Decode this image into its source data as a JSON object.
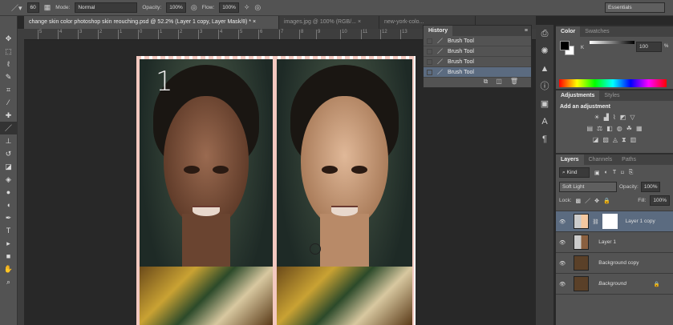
{
  "options_bar": {
    "brush_size": "60",
    "mode_label": "Mode:",
    "mode_value": "Normal",
    "opacity_label": "Opacity:",
    "opacity_value": "100%",
    "flow_label": "Flow:",
    "flow_value": "100%",
    "workspace": "Essentials"
  },
  "tabs": [
    {
      "label": "change skin color photoshop skin reouching.psd @ 52.2% (Layer 1 copy, Layer Mask/8) *",
      "close": "×"
    },
    {
      "label": "images.jpg @ 100% (RGB/...",
      "close": "×"
    },
    {
      "label": "new-york-colo..."
    }
  ],
  "ruler": [
    "5",
    "4",
    "3",
    "2",
    "1",
    "0",
    "1",
    "2",
    "3",
    "4",
    "5",
    "6",
    "7",
    "8",
    "9",
    "10",
    "11",
    "12",
    "13"
  ],
  "canvas": {
    "label_number": "1"
  },
  "history": {
    "title": "History",
    "items": [
      "Brush Tool",
      "Brush Tool",
      "Brush Tool",
      "Brush Tool"
    ]
  },
  "color_panel": {
    "tabs": [
      "Color",
      "Swatches"
    ],
    "channel": "K",
    "value": "100",
    "unit": "%"
  },
  "adjustments": {
    "tabs": [
      "Adjustments",
      "Styles"
    ],
    "heading": "Add an adjustment"
  },
  "layers": {
    "tabs": [
      "Layers",
      "Channels",
      "Paths"
    ],
    "kind": "Kind",
    "blend_mode": "Soft Light",
    "opacity_label": "Opacity:",
    "opacity": "100%",
    "lock_label": "Lock:",
    "fill_label": "Fill:",
    "fill": "100%",
    "items": [
      {
        "name": "Layer 1 copy"
      },
      {
        "name": "Layer 1"
      },
      {
        "name": "Background copy"
      },
      {
        "name": "Background"
      }
    ]
  },
  "colors": {
    "accent_selection": "#5b6b80"
  }
}
